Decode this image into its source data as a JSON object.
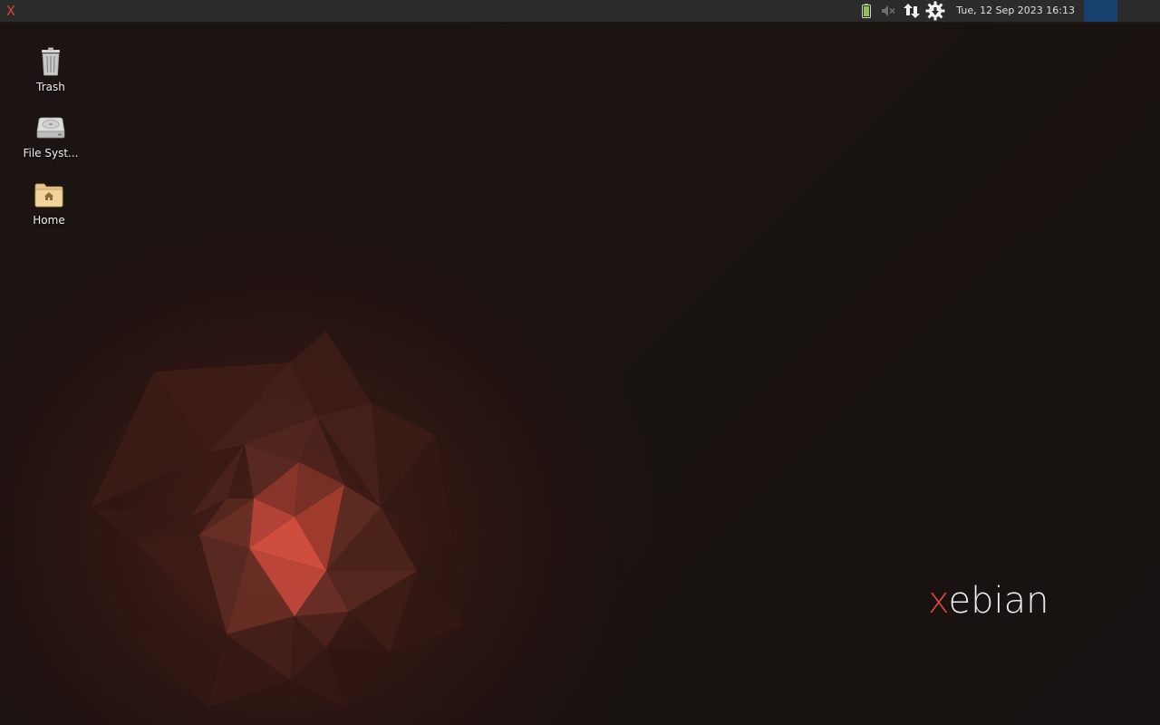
{
  "panel": {
    "menu_glyph": "X",
    "menu_icon": "xfce-app-menu-icon",
    "clock": "Tue, 12 Sep 2023 16:13",
    "tray": {
      "battery_icon": "battery-full-icon",
      "volume_icon": "volume-muted-icon",
      "network_icon": "network-transfer-icon",
      "updates_icon": "updates-gear-icon"
    },
    "workspace_color": "#17406f"
  },
  "desktop": {
    "icons": [
      {
        "label": "Trash",
        "icon": "trash-icon"
      },
      {
        "label": "File Syst...",
        "icon": "drive-harddisk-icon"
      },
      {
        "label": "Home",
        "icon": "home-folder-icon"
      }
    ],
    "logo": {
      "x_part": "x",
      "rest": "ebian"
    }
  },
  "colors": {
    "accent": "#d9453a",
    "panel_bg": "#2b2b2b",
    "desktop_bg": "#1a1310",
    "workspace_active": "#17406f"
  }
}
